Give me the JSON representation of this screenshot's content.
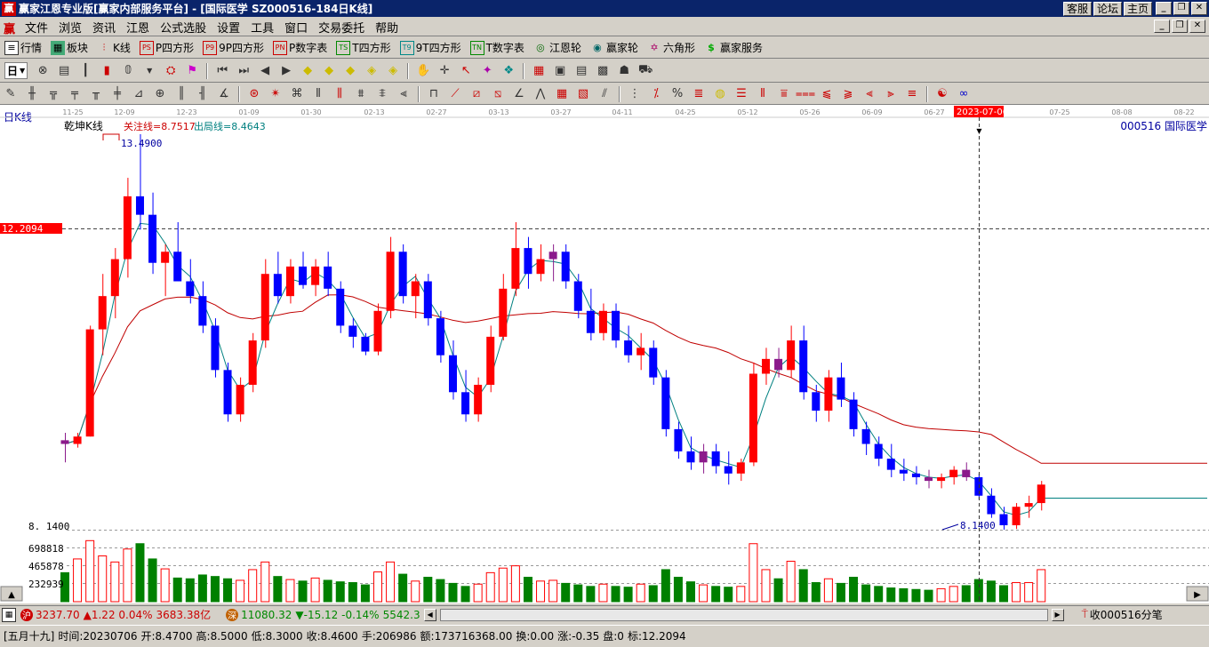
{
  "window": {
    "logo": "赢",
    "title": "赢家江恩专业版[赢家内部服务平台] - [国际医学   SZ000516-184日K线]",
    "links": [
      "客服",
      "论坛",
      "主页"
    ]
  },
  "menu": [
    "文件",
    "浏览",
    "资讯",
    "江恩",
    "公式选股",
    "设置",
    "工具",
    "窗口",
    "交易委托",
    "帮助"
  ],
  "toolbar1": [
    {
      "icon": "list-icon",
      "label": "行情"
    },
    {
      "icon": "blocks-icon",
      "label": "板块"
    },
    {
      "icon": "kline-icon",
      "label": "K线"
    },
    {
      "icon": "ps-icon",
      "label": "P四方形"
    },
    {
      "icon": "9p-icon",
      "label": "9P四方形"
    },
    {
      "icon": "pn-icon",
      "label": "P数字表"
    },
    {
      "icon": "ts-icon",
      "label": "T四方形"
    },
    {
      "icon": "t9-icon",
      "label": "9T四方形"
    },
    {
      "icon": "tn-icon",
      "label": "T数字表"
    },
    {
      "icon": "wheel-icon",
      "label": "江恩轮"
    },
    {
      "icon": "winner-wheel-icon",
      "label": "赢家轮"
    },
    {
      "icon": "hexagon-icon",
      "label": "六角形"
    },
    {
      "icon": "dollar-icon",
      "label": "赢家服务"
    }
  ],
  "toolbar2_period": "日",
  "chart": {
    "period_label": "日K线",
    "indicator_name": "乾坤K线",
    "attention_label": "关注线=8.7517",
    "exit_label": "出局线=8.4643",
    "stock_label": "000516  国际医学",
    "high_label": "13.4900",
    "low_label": "8.1400",
    "low_axis_label": "8. 1400",
    "cursor_price": "12.2094",
    "cursor_date": "2023-07-06",
    "date_ticks": [
      "11-25",
      "12-09",
      "12-23",
      "01-09",
      "01-30",
      "02-13",
      "02-27",
      "03-13",
      "03-27",
      "04-11",
      "04-25",
      "05-12",
      "05-26",
      "06-09",
      "06-27",
      "07-25",
      "08-08",
      "08-22"
    ],
    "volume_ticks": [
      "698818",
      "465878",
      "232939"
    ]
  },
  "chart_data": {
    "type": "candlestick",
    "y_range": [
      8.14,
      13.49
    ],
    "volume_range": [
      0,
      931757
    ],
    "candles": [
      [
        9.35,
        9.45,
        9.05,
        9.3
      ],
      [
        9.3,
        9.45,
        9.25,
        9.4
      ],
      [
        9.4,
        10.9,
        9.4,
        10.85
      ],
      [
        10.85,
        11.6,
        10.5,
        11.3
      ],
      [
        11.3,
        11.95,
        11.0,
        11.8
      ],
      [
        11.8,
        12.9,
        11.55,
        12.65
      ],
      [
        12.65,
        13.49,
        12.2,
        12.4
      ],
      [
        12.4,
        12.7,
        11.6,
        11.75
      ],
      [
        11.75,
        12.0,
        11.3,
        11.9
      ],
      [
        11.9,
        12.3,
        11.5,
        11.5
      ],
      [
        11.5,
        11.8,
        11.2,
        11.3
      ],
      [
        11.3,
        11.5,
        10.8,
        10.9
      ],
      [
        10.9,
        11.0,
        10.2,
        10.3
      ],
      [
        10.3,
        10.4,
        9.6,
        9.7
      ],
      [
        9.7,
        10.2,
        9.6,
        10.1
      ],
      [
        10.1,
        10.8,
        10.0,
        10.7
      ],
      [
        10.7,
        11.8,
        10.6,
        11.6
      ],
      [
        11.6,
        11.9,
        11.2,
        11.3
      ],
      [
        11.3,
        11.8,
        11.2,
        11.7
      ],
      [
        11.7,
        11.9,
        11.4,
        11.45
      ],
      [
        11.45,
        11.8,
        11.3,
        11.7
      ],
      [
        11.7,
        11.9,
        11.3,
        11.4
      ],
      [
        11.4,
        11.5,
        10.8,
        10.9
      ],
      [
        10.9,
        11.0,
        10.6,
        10.75
      ],
      [
        10.75,
        10.8,
        10.5,
        10.55
      ],
      [
        10.55,
        11.2,
        10.5,
        11.1
      ],
      [
        11.1,
        12.1,
        11.0,
        11.9
      ],
      [
        11.9,
        12.0,
        11.2,
        11.3
      ],
      [
        11.3,
        11.6,
        11.0,
        11.5
      ],
      [
        11.5,
        11.6,
        10.9,
        11.0
      ],
      [
        11.0,
        11.1,
        10.4,
        10.5
      ],
      [
        10.5,
        10.7,
        9.9,
        10.0
      ],
      [
        10.0,
        10.3,
        9.6,
        9.7
      ],
      [
        9.7,
        10.2,
        9.6,
        10.1
      ],
      [
        10.1,
        10.9,
        10.0,
        10.75
      ],
      [
        10.75,
        11.6,
        10.7,
        11.4
      ],
      [
        11.4,
        12.3,
        11.3,
        11.95
      ],
      [
        11.95,
        12.1,
        11.4,
        11.6
      ],
      [
        11.6,
        12.0,
        11.5,
        11.8
      ],
      [
        11.8,
        12.0,
        11.5,
        11.9
      ],
      [
        11.9,
        12.0,
        11.4,
        11.5
      ],
      [
        11.5,
        11.6,
        11.0,
        11.1
      ],
      [
        11.1,
        11.4,
        10.7,
        10.8
      ],
      [
        10.8,
        11.2,
        10.7,
        11.1
      ],
      [
        11.1,
        11.2,
        10.6,
        10.7
      ],
      [
        10.7,
        10.9,
        10.4,
        10.5
      ],
      [
        10.5,
        10.8,
        10.3,
        10.6
      ],
      [
        10.6,
        10.7,
        10.1,
        10.2
      ],
      [
        10.2,
        10.3,
        9.4,
        9.5
      ],
      [
        9.5,
        9.6,
        9.1,
        9.2
      ],
      [
        9.2,
        9.4,
        8.95,
        9.05
      ],
      [
        9.05,
        9.3,
        8.9,
        9.2
      ],
      [
        9.2,
        9.3,
        8.9,
        9.0
      ],
      [
        9.0,
        9.2,
        8.75,
        8.9
      ],
      [
        8.9,
        9.1,
        8.8,
        9.05
      ],
      [
        9.05,
        10.4,
        9.0,
        10.25
      ],
      [
        10.25,
        10.6,
        10.1,
        10.45
      ],
      [
        10.45,
        10.6,
        10.2,
        10.3
      ],
      [
        10.3,
        10.9,
        10.2,
        10.7
      ],
      [
        10.7,
        10.9,
        9.9,
        10.0
      ],
      [
        10.0,
        10.1,
        9.6,
        9.75
      ],
      [
        9.75,
        10.3,
        9.6,
        10.2
      ],
      [
        10.2,
        10.4,
        9.8,
        9.9
      ],
      [
        9.9,
        10.0,
        9.4,
        9.5
      ],
      [
        9.5,
        9.6,
        9.15,
        9.3
      ],
      [
        9.3,
        9.4,
        9.0,
        9.1
      ],
      [
        9.1,
        9.3,
        8.85,
        8.95
      ],
      [
        8.95,
        9.1,
        8.8,
        8.9
      ],
      [
        8.9,
        9.0,
        8.75,
        8.85
      ],
      [
        8.85,
        8.95,
        8.7,
        8.8
      ],
      [
        8.8,
        8.9,
        8.7,
        8.85
      ],
      [
        8.85,
        9.0,
        8.75,
        8.95
      ],
      [
        8.95,
        9.05,
        8.8,
        8.85
      ],
      [
        8.85,
        8.9,
        8.55,
        8.6
      ],
      [
        8.6,
        8.7,
        8.3,
        8.35
      ],
      [
        8.35,
        8.45,
        8.14,
        8.2
      ],
      [
        8.2,
        8.5,
        8.15,
        8.45
      ],
      [
        8.45,
        8.6,
        8.3,
        8.5
      ],
      [
        8.5,
        8.8,
        8.4,
        8.75
      ]
    ],
    "volumes": [
      380000,
      560000,
      800000,
      600000,
      520000,
      690000,
      760000,
      560000,
      430000,
      310000,
      300000,
      350000,
      330000,
      300000,
      280000,
      420000,
      520000,
      330000,
      290000,
      270000,
      310000,
      280000,
      260000,
      250000,
      220000,
      390000,
      520000,
      360000,
      270000,
      320000,
      290000,
      240000,
      200000,
      230000,
      380000,
      440000,
      470000,
      320000,
      270000,
      280000,
      240000,
      220000,
      200000,
      230000,
      200000,
      190000,
      230000,
      210000,
      420000,
      320000,
      260000,
      220000,
      200000,
      190000,
      200000,
      760000,
      420000,
      300000,
      530000,
      420000,
      250000,
      300000,
      240000,
      320000,
      220000,
      200000,
      180000,
      170000,
      160000,
      150000,
      170000,
      200000,
      210000,
      290000,
      270000,
      210000,
      250000,
      250000,
      420000
    ]
  },
  "status": {
    "sh_chip": "沪",
    "sh_index": "3237.70",
    "sh_change": "▲1.22 0.04%",
    "sh_amount": "3683.38亿",
    "sz_chip": "深",
    "sz_index": "11080.32",
    "sz_change": "▼-15.12 -0.14%",
    "sz_amount": "5542.3",
    "right_text": "收000516分笔"
  },
  "info": {
    "lunar": "[五月十九]",
    "time": "时间:20230706",
    "open": "开:8.4700",
    "high": "高:8.5000",
    "low": "低:8.3000",
    "close": "收:8.4600",
    "hand": "手:206986",
    "amount": "额:173716368.00",
    "turnover": "换:0.00",
    "change": "涨:-0.35",
    "disk": "盘:0",
    "mark": "标:12.2094"
  },
  "colors": {
    "up": "#ff0000",
    "down": "#0000ff",
    "purple": "#8b1a8b",
    "vol_down": "#008000",
    "slow_ma": "#c00000",
    "fast_ma": "#008080",
    "title_bg": "#0a246a"
  }
}
